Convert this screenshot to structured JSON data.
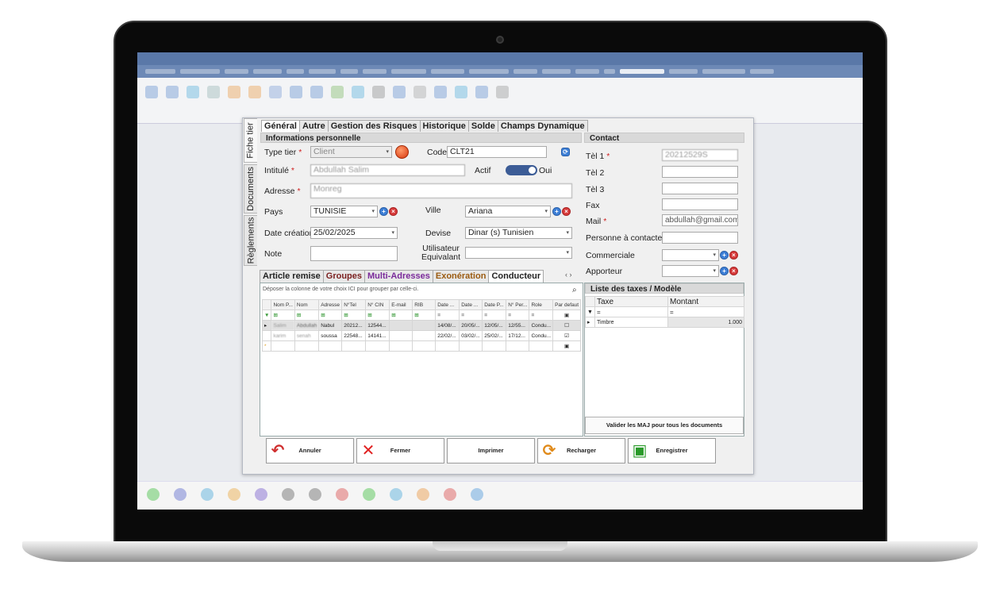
{
  "window": {
    "vtabs": [
      "Fiche tier",
      "Documents",
      "Règlements"
    ]
  },
  "tabs": [
    "Général",
    "Autre",
    "Gestion des Risques",
    "Historique",
    "Solde",
    "Champs Dynamique"
  ],
  "personal_info": {
    "header": "Informations personnelle",
    "type_tier_label": "Type tier",
    "type_tier_value": "Client",
    "code_label": "Code",
    "code_value": "CLT21",
    "intitule_label": "Intitulé",
    "intitule_value": "Abdullah Salim",
    "actif_label": "Actif",
    "actif_value": "Oui",
    "adresse_label": "Adresse",
    "adresse_value": "Monreg",
    "pays_label": "Pays",
    "pays_value": "TUNISIE",
    "ville_label": "Ville",
    "ville_value": "Ariana",
    "date_label": "Date création",
    "date_value": "25/02/2025",
    "devise_label": "Devise",
    "devise_value": "Dinar (s) Tunisien",
    "note_label": "Note",
    "note_value": "",
    "utilisateur_label_1": "Utilisateur",
    "utilisateur_label_2": "Equivalant",
    "utilisateur_value": "",
    "required_mark": "*"
  },
  "contact": {
    "header": "Contact",
    "tel1_label": "Tèl 1",
    "tel1_value": "20212529S",
    "tel2_label": "Tèl 2",
    "tel3_label": "Tèl 3",
    "fax_label": "Fax",
    "mail_label": "Mail",
    "mail_value": "abdullah@gmail.com",
    "personne_label": "Personne à contacter",
    "commerciale_label": "Commerciale",
    "apporteur_label": "Apporteur"
  },
  "subtabs": [
    "Article remise",
    "Groupes",
    "Multi-Adresses",
    "Exonération",
    "Conducteur"
  ],
  "grid": {
    "hint": "Déposer la colonne de votre choix ICI pour grouper par celle-ci.",
    "columns": [
      "Nom P...",
      "Nom",
      "Adresse",
      "N°Tel",
      "N° CIN",
      "E-mail",
      "RIB",
      "Date ...",
      "Date ...",
      "Date P...",
      "N° Per...",
      "Role",
      "Par defaut"
    ],
    "rows": [
      [
        "Salim",
        "Abdullah",
        "Nabul",
        "20212...",
        "12544...",
        "",
        "",
        "14/08/...",
        "20/05/...",
        "12/05/...",
        "12/55...",
        "Condu..."
      ],
      [
        "karim",
        "senah",
        "soussa",
        "22548...",
        "14141...",
        "",
        "",
        "22/02/...",
        "03/02/...",
        "25/02/...",
        "17/12...",
        "Condu..."
      ]
    ]
  },
  "taxes": {
    "header": "Liste des taxes / Modèle",
    "col_taxe": "Taxe",
    "col_montant": "Montant",
    "row_name": "Timbre",
    "row_value": "1.000",
    "valider": "Valider les MAJ pour tous les documents"
  },
  "actions": {
    "annuler": "Annuler",
    "fermer": "Fermer",
    "imprimer": "Imprimer",
    "recharger": "Recharger",
    "enregistrer": "Enregistrer"
  }
}
